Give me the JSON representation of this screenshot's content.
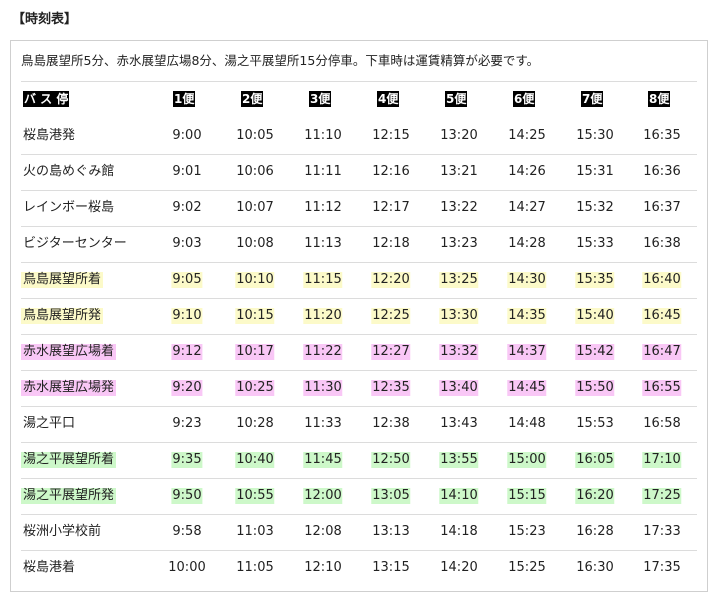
{
  "heading": "【時刻表】",
  "notice": "鳥島展望所5分、赤水展望広場8分、湯之平展望所15分停車。下車時は運賃精算が必要です。",
  "colors": {
    "yellow": "#fcfac9",
    "pink": "#f9c7f6",
    "green": "#cdf8c9",
    "header_bg": "#000000"
  },
  "header": {
    "stop_label": " バ ス 停 ",
    "trips": [
      "1便",
      "2便",
      "3便",
      "4便",
      "5便",
      "6便",
      "7便",
      "8便"
    ]
  },
  "rows": [
    {
      "stop": "桜島港発",
      "highlight": "",
      "times": [
        "9:00",
        "10:05",
        "11:10",
        "12:15",
        "13:20",
        "14:25",
        "15:30",
        "16:35"
      ]
    },
    {
      "stop": "火の島めぐみ館",
      "highlight": "",
      "times": [
        "9:01",
        "10:06",
        "11:11",
        "12:16",
        "13:21",
        "14:26",
        "15:31",
        "16:36"
      ]
    },
    {
      "stop": "レインボー桜島",
      "highlight": "",
      "times": [
        "9:02",
        "10:07",
        "11:12",
        "12:17",
        "13:22",
        "14:27",
        "15:32",
        "16:37"
      ]
    },
    {
      "stop": "ビジターセンター",
      "highlight": "",
      "times": [
        "9:03",
        "10:08",
        "11:13",
        "12:18",
        "13:23",
        "14:28",
        "15:33",
        "16:38"
      ]
    },
    {
      "stop": "鳥島展望所着",
      "highlight": "yellow",
      "times": [
        "9:05",
        "10:10",
        "11:15",
        "12:20",
        "13:25",
        "14:30",
        "15:35",
        "16:40"
      ]
    },
    {
      "stop": "鳥島展望所発",
      "highlight": "yellow",
      "times": [
        "9:10",
        "10:15",
        "11:20",
        "12:25",
        "13:30",
        "14:35",
        "15:40",
        "16:45"
      ]
    },
    {
      "stop": "赤水展望広場着",
      "highlight": "pink",
      "times": [
        "9:12",
        "10:17",
        "11:22",
        "12:27",
        "13:32",
        "14:37",
        "15:42",
        "16:47"
      ]
    },
    {
      "stop": "赤水展望広場発",
      "highlight": "pink",
      "times": [
        "9:20",
        "10:25",
        "11:30",
        "12:35",
        "13:40",
        "14:45",
        "15:50",
        "16:55"
      ]
    },
    {
      "stop": "湯之平口",
      "highlight": "",
      "times": [
        "9:23",
        "10:28",
        "11:33",
        "12:38",
        "13:43",
        "14:48",
        "15:53",
        "16:58"
      ]
    },
    {
      "stop": "湯之平展望所着",
      "highlight": "green",
      "times": [
        "9:35",
        "10:40",
        "11:45",
        "12:50",
        "13:55",
        "15:00",
        "16:05",
        "17:10"
      ]
    },
    {
      "stop": "湯之平展望所発",
      "highlight": "green",
      "times": [
        "9:50",
        "10:55",
        "12:00",
        "13:05",
        "14:10",
        "15:15",
        "16:20",
        "17:25"
      ]
    },
    {
      "stop": "桜洲小学校前",
      "highlight": "",
      "times": [
        "9:58",
        "11:03",
        "12:08",
        "13:13",
        "14:18",
        "15:23",
        "16:28",
        "17:33"
      ]
    },
    {
      "stop": "桜島港着",
      "highlight": "",
      "times": [
        "10:00",
        "11:05",
        "12:10",
        "13:15",
        "14:20",
        "15:25",
        "16:30",
        "17:35"
      ]
    }
  ]
}
